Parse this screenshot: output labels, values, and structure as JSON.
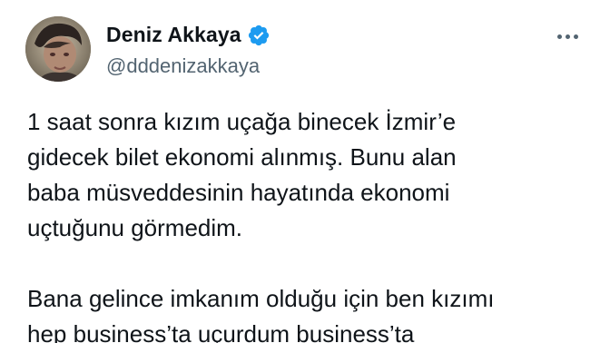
{
  "author": {
    "display_name": "Deniz Akkaya",
    "handle": "@dddenizakkaya",
    "verified": true,
    "verified_color": "#1d9bf0"
  },
  "icons": {
    "verified": "verified-badge-icon",
    "more": "more-options-icon"
  },
  "tweet": {
    "text": "1 saat sonra kızım uçağa binecek İzmir’e\ngidecek bilet ekonomi alınmış. Bunu alan\nbaba müsveddesinin hayatında ekonomi\nuçtuğunu görmedim.\n\nBana gelince imkanım olduğu için ben kızımı\nhep business’ta uçurdum business’ta"
  }
}
